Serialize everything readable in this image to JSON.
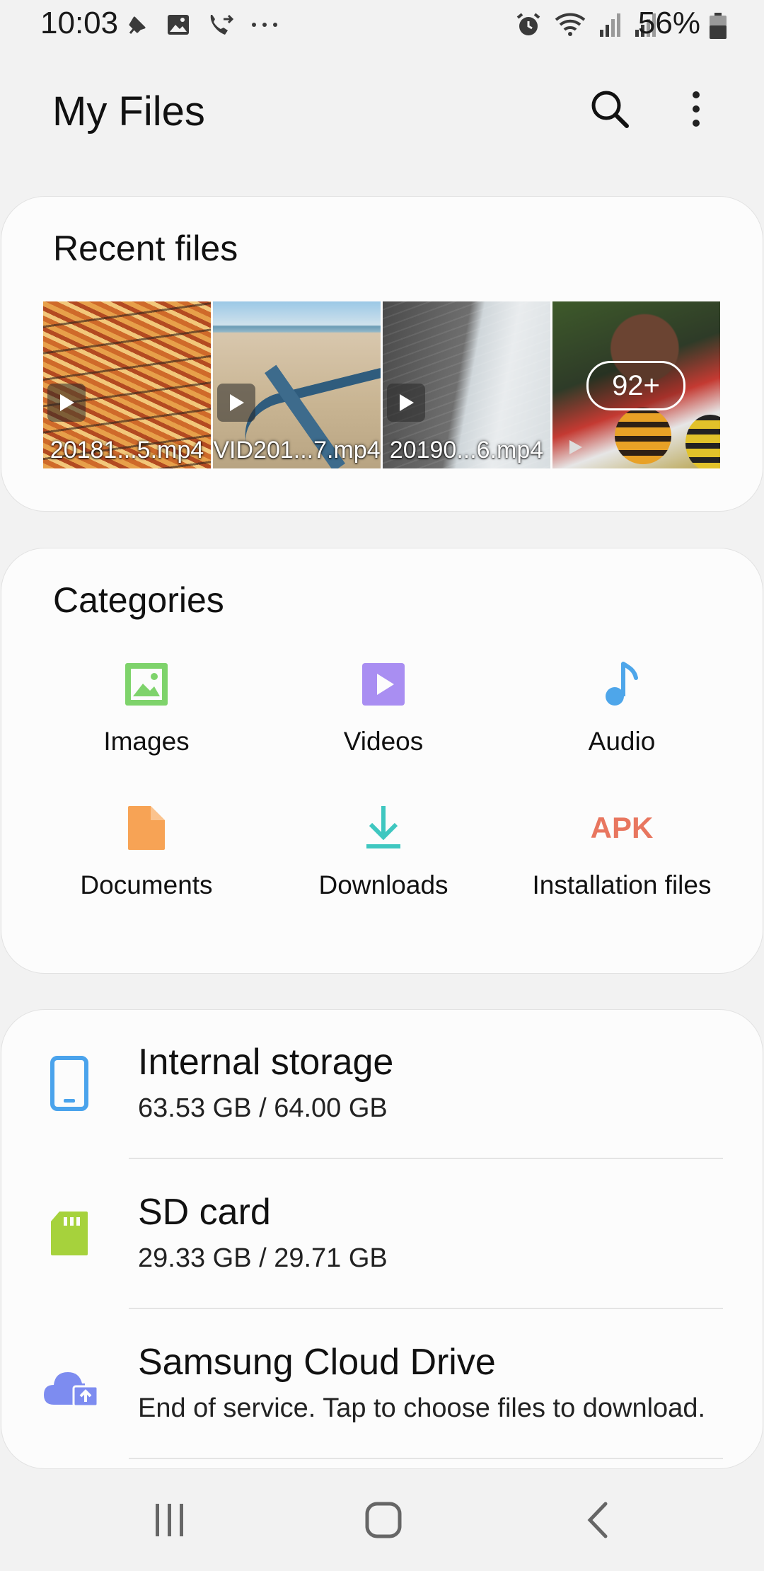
{
  "status_bar": {
    "time": "10:03",
    "battery_percent": "56%",
    "left_icons": [
      "pin-icon",
      "image-icon",
      "call-forward-icon",
      "more-dots-icon"
    ],
    "right_icons": [
      "alarm-icon",
      "wifi-icon",
      "signal-icon",
      "signal-icon",
      "battery-icon"
    ]
  },
  "app_bar": {
    "title": "My Files",
    "actions": [
      "search-icon",
      "more-options-icon"
    ]
  },
  "recent": {
    "title": "Recent files",
    "items": [
      {
        "name": "20181...5.mp4",
        "type": "video"
      },
      {
        "name": "VID201...7.mp4",
        "type": "video"
      },
      {
        "name": "20190...6.mp4",
        "type": "video"
      }
    ],
    "more_count": "92+"
  },
  "categories": {
    "title": "Categories",
    "items": [
      {
        "label": "Images",
        "icon": "image-icon",
        "color": "#7ed36b"
      },
      {
        "label": "Videos",
        "icon": "video-icon",
        "color": "#a98ef2"
      },
      {
        "label": "Audio",
        "icon": "music-note-icon",
        "color": "#4ea6ea"
      },
      {
        "label": "Documents",
        "icon": "document-icon",
        "color": "#f7a355"
      },
      {
        "label": "Downloads",
        "icon": "download-icon",
        "color": "#3fc7c0"
      },
      {
        "label": "Installation files",
        "icon": "apk-icon",
        "icon_text": "APK",
        "color": "#e8765f"
      }
    ]
  },
  "storage": [
    {
      "title": "Internal storage",
      "detail": "63.53 GB / 64.00 GB",
      "icon": "phone-icon",
      "color": "#4aa3ec"
    },
    {
      "title": "SD card",
      "detail": "29.33 GB / 29.71 GB",
      "icon": "sd-card-icon",
      "color": "#a6d23c"
    },
    {
      "title": "Samsung Cloud Drive",
      "detail": "End of service. Tap to choose files to download.",
      "icon": "cloud-upload-icon",
      "color": "#7d8cf0"
    }
  ],
  "nav": [
    "recents-icon",
    "home-icon",
    "back-icon"
  ]
}
